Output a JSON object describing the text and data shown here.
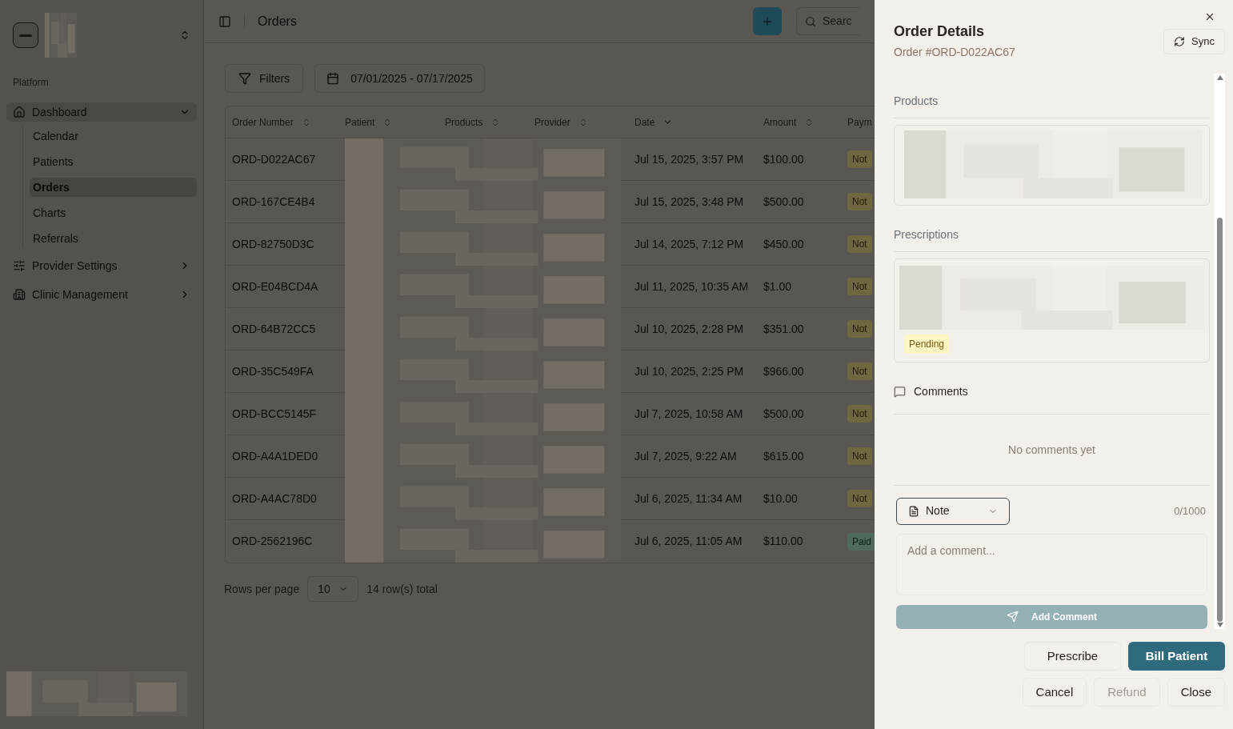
{
  "sidebar": {
    "section_label": "Platform",
    "items": [
      {
        "label": "Dashboard",
        "expanded": true,
        "children": [
          {
            "label": "Calendar",
            "selected": false
          },
          {
            "label": "Patients",
            "selected": false
          },
          {
            "label": "Orders",
            "selected": true
          },
          {
            "label": "Charts",
            "selected": false
          },
          {
            "label": "Referrals",
            "selected": false
          }
        ]
      },
      {
        "label": "Provider Settings",
        "expanded": false
      },
      {
        "label": "Clinic Management",
        "expanded": false
      }
    ]
  },
  "header": {
    "title": "Orders",
    "search_placeholder": "Searc"
  },
  "toolbar": {
    "filters_label": "Filters",
    "date_range": "07/01/2025 - 07/17/2025"
  },
  "table": {
    "columns": [
      {
        "label": "Order Number",
        "sorted": false
      },
      {
        "label": "Patient",
        "sorted": false
      },
      {
        "label": "Products",
        "sorted": false
      },
      {
        "label": "Provider",
        "sorted": false
      },
      {
        "label": "Date",
        "sorted": true
      },
      {
        "label": "Amount",
        "sorted": false
      },
      {
        "label": "Paym"
      }
    ],
    "rows": [
      {
        "order_number": "ORD-D022AC67",
        "date": "Jul 15, 2025, 3:57 PM",
        "amount": "$100.00",
        "payment": {
          "label": "Not",
          "kind": "unpaid"
        }
      },
      {
        "order_number": "ORD-167CE4B4",
        "date": "Jul 15, 2025, 3:48 PM",
        "amount": "$500.00",
        "payment": {
          "label": "Not",
          "kind": "unpaid"
        }
      },
      {
        "order_number": "ORD-82750D3C",
        "date": "Jul 14, 2025, 7:12 PM",
        "amount": "$450.00",
        "payment": {
          "label": "Not",
          "kind": "unpaid"
        }
      },
      {
        "order_number": "ORD-E04BCD4A",
        "date": "Jul 11, 2025, 10:35 AM",
        "amount": "$1.00",
        "payment": {
          "label": "Not",
          "kind": "unpaid"
        }
      },
      {
        "order_number": "ORD-64B72CC5",
        "date": "Jul 10, 2025, 2:28 PM",
        "amount": "$351.00",
        "payment": {
          "label": "Not",
          "kind": "unpaid"
        }
      },
      {
        "order_number": "ORD-35C549FA",
        "date": "Jul 10, 2025, 2:25 PM",
        "amount": "$966.00",
        "payment": {
          "label": "Not",
          "kind": "unpaid"
        }
      },
      {
        "order_number": "ORD-BCC5145F",
        "date": "Jul 7, 2025, 10:58 AM",
        "amount": "$500.00",
        "payment": {
          "label": "Not",
          "kind": "unpaid"
        }
      },
      {
        "order_number": "ORD-A4A1DED0",
        "date": "Jul 7, 2025, 9:22 AM",
        "amount": "$615.00",
        "payment": {
          "label": "Not",
          "kind": "unpaid"
        }
      },
      {
        "order_number": "ORD-A4AC78D0",
        "date": "Jul 6, 2025, 11:34 AM",
        "amount": "$10.00",
        "payment": {
          "label": "Not",
          "kind": "unpaid"
        }
      },
      {
        "order_number": "ORD-2562196C",
        "date": "Jul 6, 2025, 11:05 AM",
        "amount": "$110.00",
        "payment": {
          "label": "Paid",
          "kind": "paid"
        }
      }
    ]
  },
  "pagination": {
    "rows_per_page_label": "Rows per page",
    "rows_per_page": "10",
    "total": "14 row(s) total"
  },
  "drawer": {
    "title": "Order Details",
    "subtitle": "Order #ORD-D022AC67",
    "sync_label": "Sync",
    "products_label": "Products",
    "prescriptions_label": "Prescriptions",
    "prescription_status": "Pending",
    "comments_label": "Comments",
    "empty_text": "No comments yet",
    "comment_type": "Note",
    "char_count": "0/1000",
    "comment_placeholder": "Add a comment...",
    "add_comment": {
      "label": "Add Comment",
      "disabled": true
    },
    "actions": [
      [
        {
          "label": "Prescribe",
          "kind": "outline",
          "disabled": false
        },
        {
          "label": "Bill Patient",
          "kind": "primary",
          "disabled": false
        }
      ],
      [
        {
          "label": "Cancel",
          "kind": "outline",
          "disabled": false
        },
        {
          "label": "Refund",
          "kind": "outline",
          "disabled": true
        },
        {
          "label": "Close",
          "kind": "outline",
          "disabled": false
        }
      ]
    ]
  }
}
